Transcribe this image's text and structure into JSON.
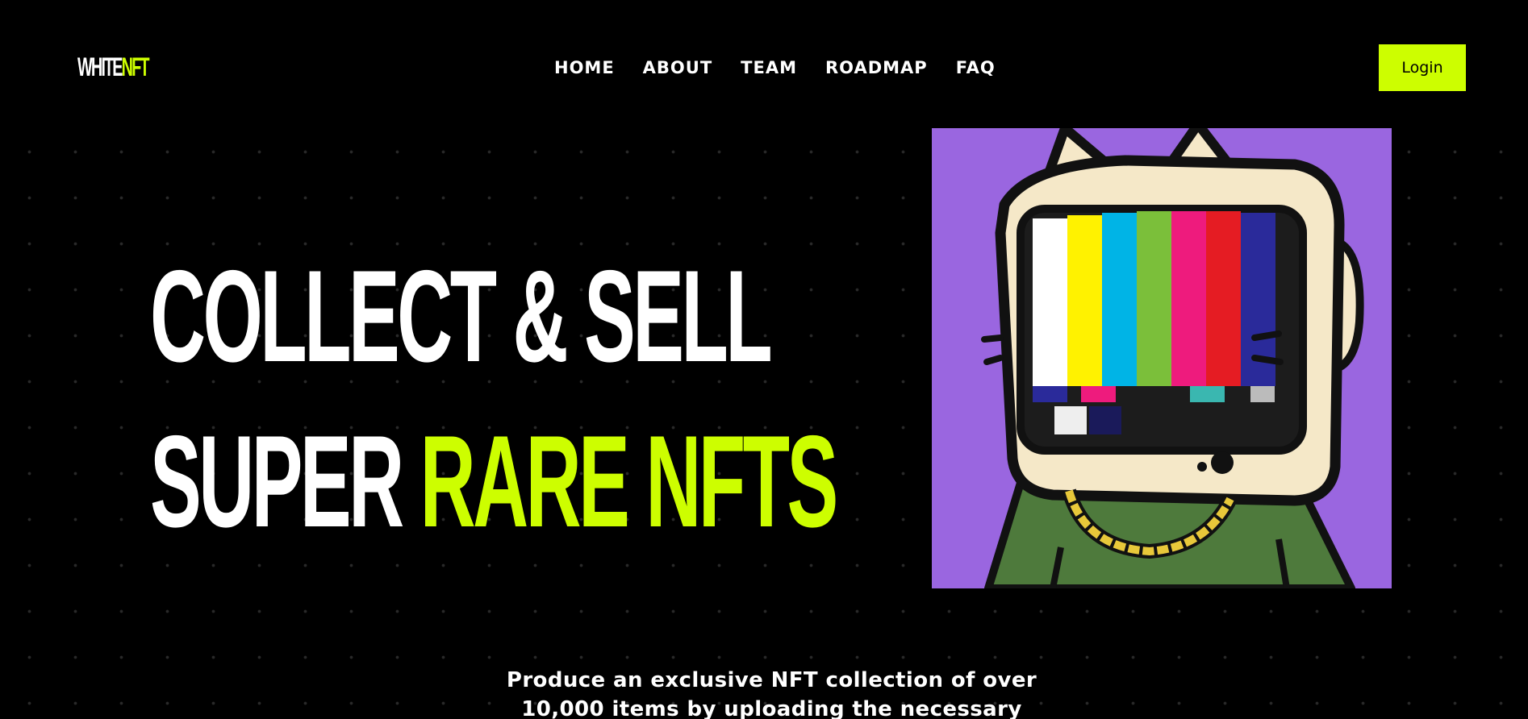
{
  "header": {
    "logo": {
      "part1": "WHITE",
      "part2": "NFT"
    },
    "nav": [
      "HOME",
      "ABOUT",
      "TEAM",
      "ROADMAP",
      "FAQ"
    ],
    "login_label": "Login"
  },
  "hero": {
    "headline_line1": "COLLECT & SELL",
    "headline_line2_white": "SUPER",
    "headline_line2_accent": "RARE NFTS",
    "description": "Produce an exclusive NFT collection of over 10,000 items by uploading the necessary"
  },
  "colors": {
    "background": "#000000",
    "accent": "#cdfe00",
    "art_background": "#9a66e0"
  }
}
